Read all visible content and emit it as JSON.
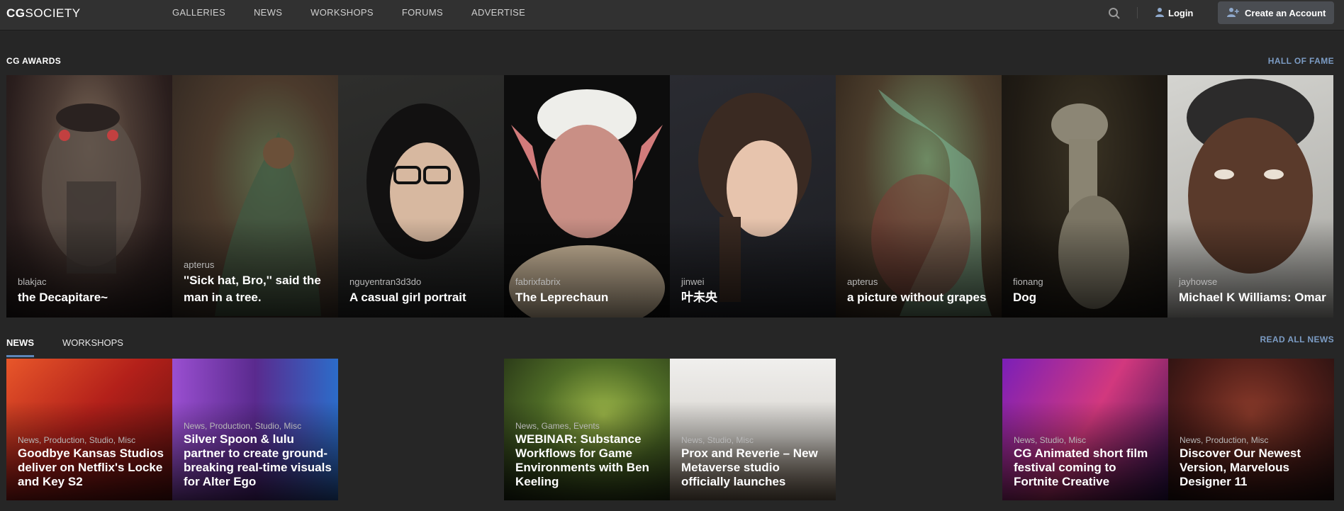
{
  "brand": {
    "logo_bold": "CG",
    "logo_rest": "SOCIETY"
  },
  "nav": {
    "items": [
      {
        "label": "GALLERIES"
      },
      {
        "label": "NEWS"
      },
      {
        "label": "WORKSHOPS"
      },
      {
        "label": "FORUMS"
      },
      {
        "label": "ADVERTISE"
      }
    ],
    "search_icon": "search-icon",
    "login_label": "Login",
    "create_label": "Create an Account"
  },
  "awards": {
    "title": "CG AWARDS",
    "link": "HALL OF FAME",
    "items": [
      {
        "author": "blakjac",
        "title": "the Decapitare~"
      },
      {
        "author": "apterus",
        "title": "''Sick hat, Bro,'' said the man in a tree."
      },
      {
        "author": "nguyentran3d3do",
        "title": "A casual girl portrait"
      },
      {
        "author": "fabrixfabrix",
        "title": "The Leprechaun"
      },
      {
        "author": "jinwei",
        "title": "叶未央"
      },
      {
        "author": "apterus",
        "title": "a picture without grapes"
      },
      {
        "author": "fionang",
        "title": "Dog"
      },
      {
        "author": "jayhowse",
        "title": "Michael K Williams: Omar"
      }
    ]
  },
  "news": {
    "tabs": [
      {
        "label": "NEWS"
      },
      {
        "label": "WORKSHOPS"
      }
    ],
    "link": "READ ALL NEWS",
    "items": [
      {
        "cats": "News, Production, Studio, Misc",
        "title": "Goodbye Kansas Studios deliver on Netflix's Locke and Key S2"
      },
      {
        "cats": "News, Production, Studio, Misc",
        "title": "Silver Spoon & lulu partner to create ground-breaking real-time visuals for Alter Ego"
      },
      {
        "cats": "News, Games, Events",
        "title": "WEBINAR: Substance Workflows for Game Environments with Ben Keeling"
      },
      {
        "cats": "News, Studio, Misc",
        "title": "Prox and Reverie – New Metaverse studio officially launches"
      },
      {
        "cats": "News, Studio, Misc",
        "title": "CG Animated short film festival coming to Fortnite Creative"
      },
      {
        "cats": "News, Production, Misc",
        "title": "Discover Our Newest Version, Marvelous Designer 11"
      }
    ]
  },
  "colors": {
    "accent": "#7c9cc4",
    "background": "#262626",
    "topbar": "#313131"
  }
}
